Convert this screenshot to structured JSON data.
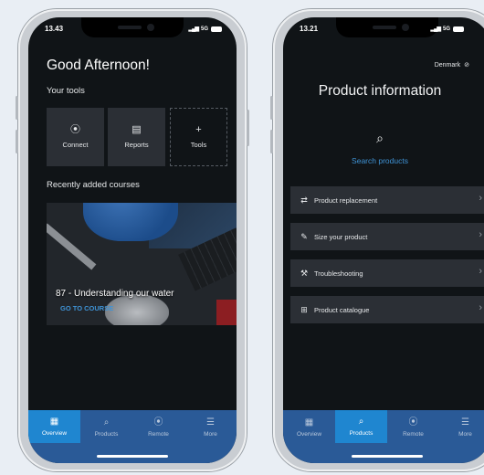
{
  "left_phone": {
    "status_time": "13.43",
    "status_net": "5G",
    "greeting": "Good Afternoon!",
    "tools_heading": "Your tools",
    "tools": [
      {
        "label": "Connect",
        "icon": "remote-icon"
      },
      {
        "label": "Reports",
        "icon": "clipboard-icon"
      },
      {
        "label": "Tools",
        "icon": "plus-icon"
      }
    ],
    "courses_heading": "Recently added courses",
    "course": {
      "title": "87 - Understanding our water",
      "cta": "GO TO COURSE"
    },
    "tabs": [
      {
        "label": "Overview",
        "icon": "grid-icon",
        "active": true
      },
      {
        "label": "Products",
        "icon": "search-icon",
        "active": false
      },
      {
        "label": "Remote",
        "icon": "remote-icon",
        "active": false
      },
      {
        "label": "More",
        "icon": "menu-icon",
        "active": false
      }
    ]
  },
  "right_phone": {
    "status_time": "13.21",
    "status_net": "5G",
    "country": "Denmark",
    "title": "Product information",
    "search_label": "Search products",
    "menu": [
      {
        "label": "Product replacement",
        "icon": "replace-icon"
      },
      {
        "label": "Size your product",
        "icon": "ruler-icon"
      },
      {
        "label": "Troubleshooting",
        "icon": "wrench-icon"
      },
      {
        "label": "Product catalogue",
        "icon": "book-icon"
      }
    ],
    "tabs": [
      {
        "label": "Overview",
        "icon": "grid-icon",
        "active": false
      },
      {
        "label": "Products",
        "icon": "search-icon",
        "active": true
      },
      {
        "label": "Remote",
        "icon": "remote-icon",
        "active": false
      },
      {
        "label": "More",
        "icon": "menu-icon",
        "active": false
      }
    ]
  },
  "colors": {
    "accent": "#3f93d6",
    "tabbar": "#2a5a97",
    "tab_active": "#1f86d0",
    "tile": "#2b2f35",
    "screen_bg": "#101417"
  }
}
